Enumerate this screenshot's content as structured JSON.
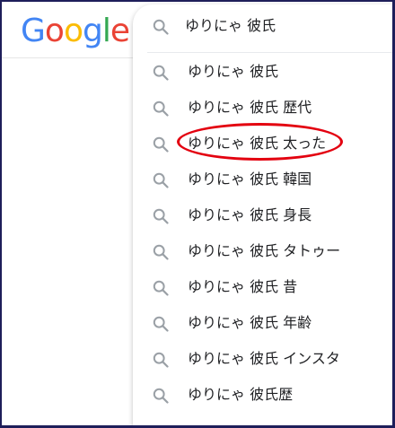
{
  "logo": {
    "letters": [
      "G",
      "o",
      "o",
      "g",
      "l",
      "e"
    ],
    "colors": [
      "#4285F4",
      "#EA4335",
      "#FBBC05",
      "#4285F4",
      "#34A853",
      "#EA4335"
    ]
  },
  "search": {
    "query": "ゆりにゃ 彼氏",
    "icon": "search-icon"
  },
  "suggestions": [
    {
      "label": "ゆりにゃ 彼氏",
      "icon": "search-icon"
    },
    {
      "label": "ゆりにゃ 彼氏 歴代",
      "icon": "search-icon"
    },
    {
      "label": "ゆりにゃ 彼氏 太った",
      "icon": "search-icon",
      "highlighted": true
    },
    {
      "label": "ゆりにゃ 彼氏 韓国",
      "icon": "search-icon"
    },
    {
      "label": "ゆりにゃ 彼氏 身長",
      "icon": "search-icon"
    },
    {
      "label": "ゆりにゃ 彼氏 タトゥー",
      "icon": "search-icon"
    },
    {
      "label": "ゆりにゃ 彼氏 昔",
      "icon": "search-icon"
    },
    {
      "label": "ゆりにゃ 彼氏 年齢",
      "icon": "search-icon"
    },
    {
      "label": "ゆりにゃ 彼氏 インスタ",
      "icon": "search-icon"
    },
    {
      "label": "ゆりにゃ 彼氏歴",
      "icon": "search-icon"
    }
  ],
  "colors": {
    "highlight": "#e3000f",
    "text": "#202124",
    "icon": "#9aa0a6",
    "frame": "#1e1e5a"
  }
}
